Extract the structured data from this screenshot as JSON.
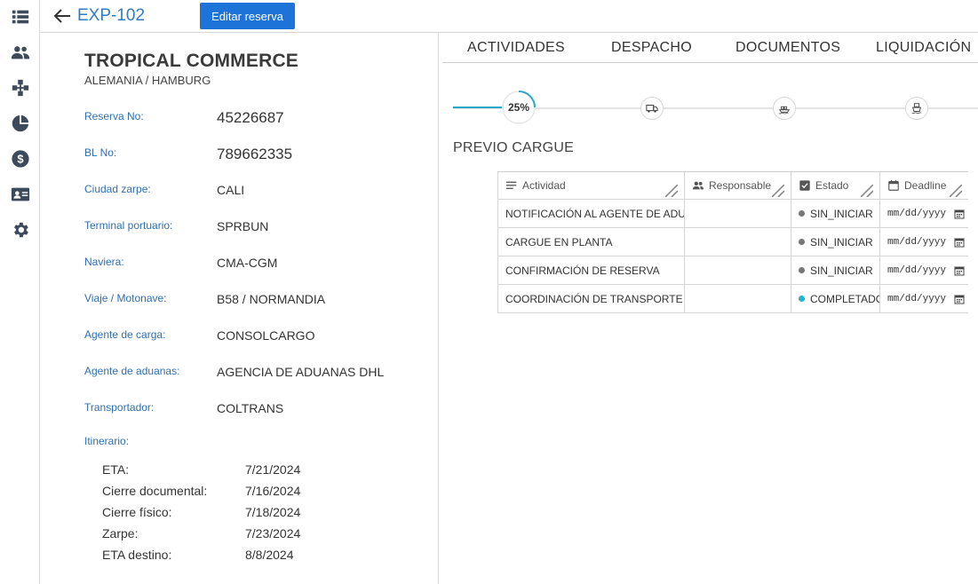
{
  "header": {
    "back_icon": "arrow-left-icon",
    "exp_id": "EXP-102",
    "edit_button": "Editar reserva"
  },
  "sidebar": {
    "items": [
      {
        "icon": "list-icon"
      },
      {
        "icon": "users-icon"
      },
      {
        "icon": "network-icon"
      },
      {
        "icon": "pie-chart-icon"
      },
      {
        "icon": "dollar-icon"
      },
      {
        "icon": "contact-card-icon"
      },
      {
        "icon": "gear-icon"
      }
    ]
  },
  "booking": {
    "company": "TROPICAL COMMERCE",
    "country_city": "ALEMANIA / HAMBURG",
    "fields": [
      {
        "label": "Reserva No:",
        "value": "45226687"
      },
      {
        "label": "BL No:",
        "value": "789662335"
      },
      {
        "label": "Ciudad zarpe:",
        "value": "CALI"
      },
      {
        "label": "Terminal portuario:",
        "value": "SPRBUN"
      },
      {
        "label": "Naviera:",
        "value": "CMA-CGM"
      },
      {
        "label": "Viaje / Motonave:",
        "value": "B58 / NORMANDIA"
      },
      {
        "label": "Agente de carga:",
        "value": "CONSOLCARGO"
      },
      {
        "label": "Agente de aduanas:",
        "value": "AGENCIA DE ADUANAS DHL"
      },
      {
        "label": "Transportador:",
        "value": "COLTRANS"
      }
    ],
    "itinerary_label": "Itinerario:",
    "itinerary": [
      {
        "label": "ETA:",
        "value": "7/21/2024"
      },
      {
        "label": "Cierre documental:",
        "value": "7/16/2024"
      },
      {
        "label": "Cierre físico:",
        "value": "7/18/2024"
      },
      {
        "label": "Zarpe:",
        "value": "7/23/2024"
      },
      {
        "label": "ETA destino:",
        "value": "8/8/2024"
      }
    ]
  },
  "tabs": [
    "ACTIVIDADES",
    "DESPACHO",
    "DOCUMENTOS",
    "LIQUIDACIÓN"
  ],
  "progress": {
    "percent_label": "25%",
    "percent": 0.25,
    "steps": [
      "truck-icon",
      "ship-loading-icon",
      "ship-icon"
    ]
  },
  "section_title": "PREVIO CARGUE",
  "table": {
    "headers": [
      "Actividad",
      "Responsable",
      "Estado",
      "Deadline"
    ],
    "rows": [
      {
        "actividad": "NOTIFICACIÓN AL AGENTE DE ADUANAS",
        "responsable": "",
        "estado": "SIN_INICIAR",
        "deadline": "mm/dd/yyyy"
      },
      {
        "actividad": "CARGUE EN PLANTA",
        "responsable": "",
        "estado": "SIN_INICIAR",
        "deadline": "mm/dd/yyyy"
      },
      {
        "actividad": "CONFIRMACIÓN DE RESERVA",
        "responsable": "",
        "estado": "SIN_INICIAR",
        "deadline": "mm/dd/yyyy"
      },
      {
        "actividad": "COORDINACIÓN DE TRANSPORTE TERRESTRE",
        "responsable": "",
        "estado": "COMPLETADO",
        "deadline": "mm/dd/yyyy"
      }
    ]
  },
  "colors": {
    "accent": "#2f7cc3",
    "button": "#1e73d9",
    "status_pending": "#777777",
    "status_done": "#1fb4d4",
    "progress": "#2aa6c9"
  }
}
